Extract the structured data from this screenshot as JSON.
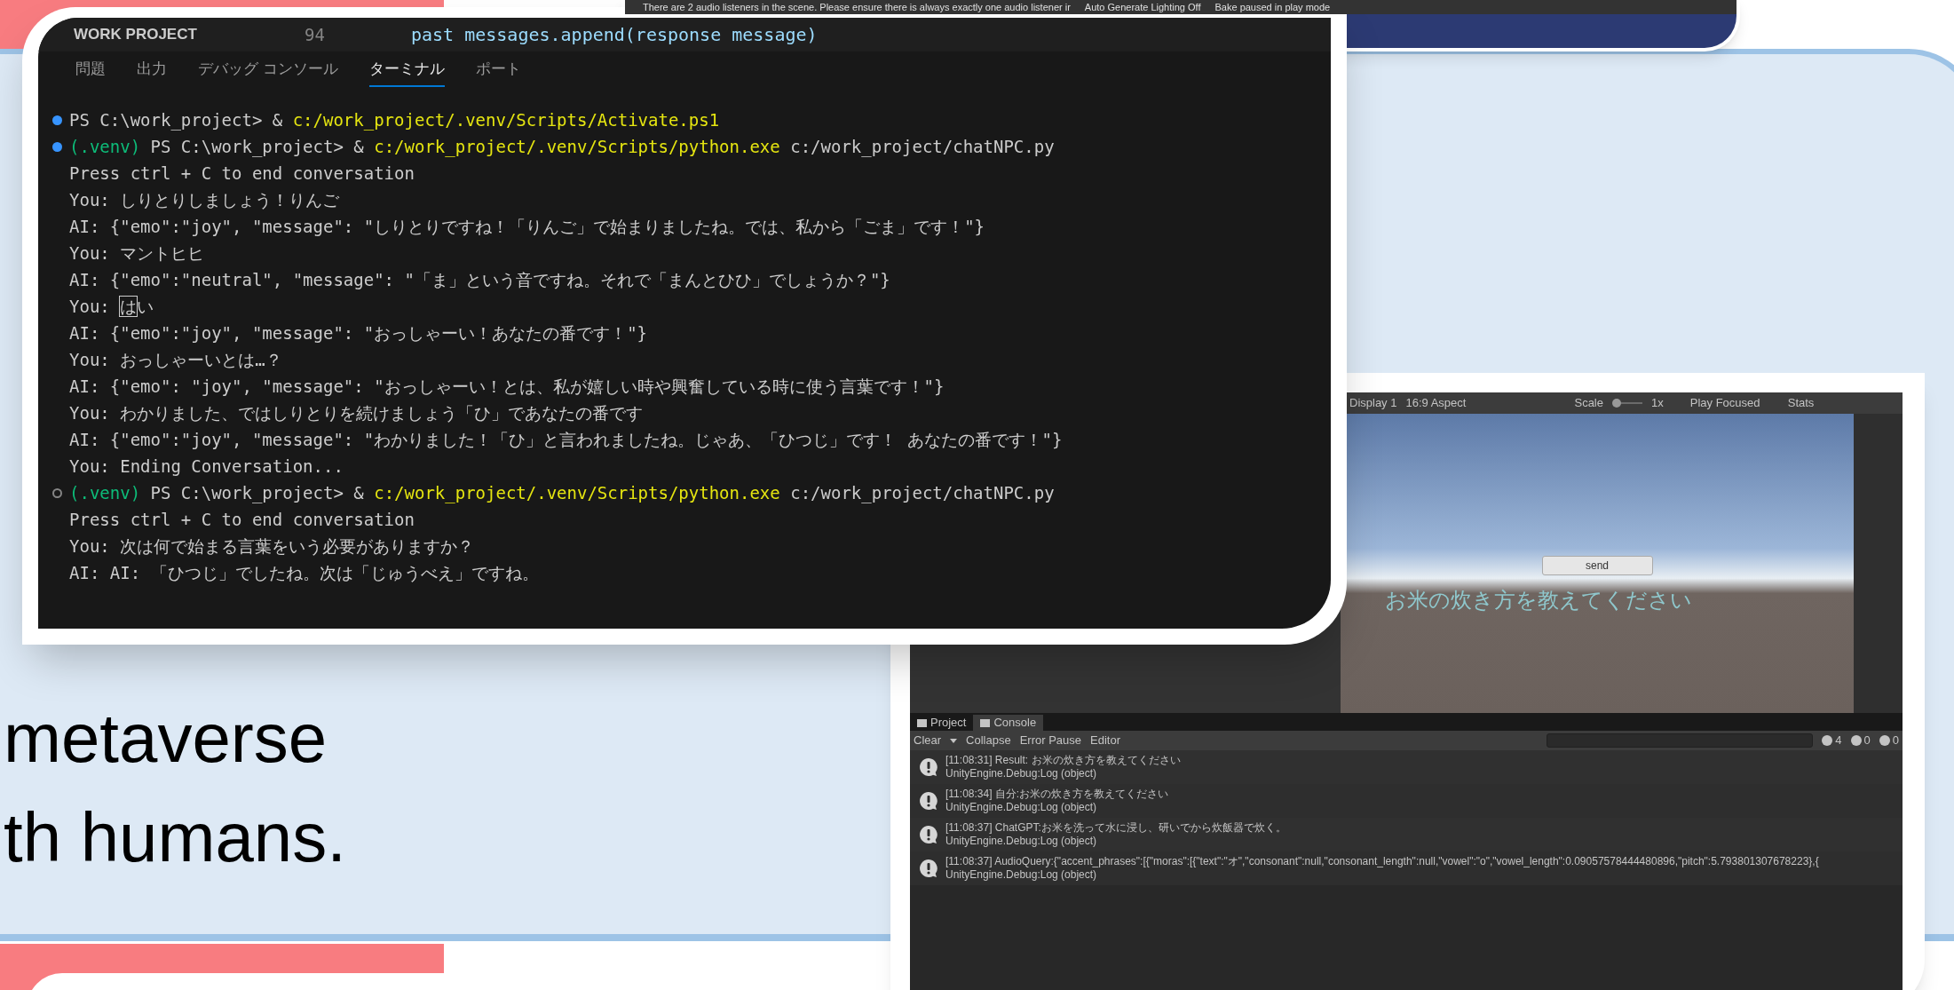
{
  "top_window": {
    "status_text": "There are 2 audio listeners in the scene. Please ensure there is always exactly one audio listener ir",
    "status_items": [
      "Auto Generate Lighting Off",
      "Bake paused in play mode"
    ]
  },
  "terminal": {
    "explorer_title": "WORK PROJECT",
    "line_number": "94",
    "code_line": "past messages.append(response message)",
    "tabs": [
      {
        "label": "問題",
        "selected": false
      },
      {
        "label": "出力",
        "selected": false
      },
      {
        "label": "デバッグ コンソール",
        "selected": false
      },
      {
        "label": "ターミナル",
        "selected": true
      },
      {
        "label": "ポート",
        "selected": false
      }
    ],
    "lines": [
      {
        "succeeded": true,
        "segments": [
          {
            "kind": "plain",
            "text": "PS C:\\work_project> & "
          },
          {
            "kind": "path",
            "text": "c:/work_project/.venv/Scripts/Activate.ps1"
          }
        ]
      },
      {
        "succeeded": true,
        "segments": [
          {
            "kind": "venv",
            "text": "(.venv)"
          },
          {
            "kind": "plain",
            "text": " PS C:\\work_project> & "
          },
          {
            "kind": "path",
            "text": "c:/work_project/.venv/Scripts/python.exe"
          },
          {
            "kind": "plain",
            "text": " c:/work_project/chatNPC.py"
          }
        ]
      },
      {
        "segments": [
          {
            "kind": "plain",
            "text": "Press ctrl + C to end conversation"
          }
        ]
      },
      {
        "segments": [
          {
            "kind": "plain",
            "text": "You: しりとりしましょう！りんご"
          }
        ]
      },
      {
        "segments": [
          {
            "kind": "plain",
            "text": "AI:  {\"emo\":\"joy\", \"message\": \"しりとりですね！「りんご」で始まりましたね。では、私から「ごま」です！\"}"
          }
        ]
      },
      {
        "segments": [
          {
            "kind": "plain",
            "text": "You: マントヒヒ"
          }
        ]
      },
      {
        "segments": [
          {
            "kind": "plain",
            "text": "AI:  {\"emo\":\"neutral\", \"message\": \"「ま」という音ですね。それで「まんとひひ」でしょうか？\"}"
          }
        ]
      },
      {
        "segments": [
          {
            "kind": "plain",
            "text": "You: "
          },
          {
            "kind": "cursor",
            "text": "は"
          },
          {
            "kind": "plain",
            "text": "い"
          }
        ]
      },
      {
        "segments": [
          {
            "kind": "plain",
            "text": "AI:  {\"emo\":\"joy\", \"message\": \"おっしゃーい！あなたの番です！\"}"
          }
        ]
      },
      {
        "segments": [
          {
            "kind": "plain",
            "text": "You: おっしゃーいとは…？"
          }
        ]
      },
      {
        "segments": [
          {
            "kind": "plain",
            "text": "AI:  {\"emo\": \"joy\", \"message\": \"おっしゃーい！とは、私が嬉しい時や興奮している時に使う言葉です！\"}"
          }
        ]
      },
      {
        "segments": [
          {
            "kind": "plain",
            "text": "You: わかりました、ではしりとりを続けましょう「ひ」であなたの番です"
          }
        ]
      },
      {
        "segments": [
          {
            "kind": "plain",
            "text": "AI:  {\"emo\":\"joy\", \"message\": \"わかりました！「ひ」と言われましたね。じゃあ、「ひつじ」です！ あなたの番です！\"}"
          }
        ]
      },
      {
        "segments": [
          {
            "kind": "plain",
            "text": "You: Ending Conversation..."
          }
        ]
      },
      {
        "succeeded": false,
        "segments": [
          {
            "kind": "venv",
            "text": "(.venv)"
          },
          {
            "kind": "plain",
            "text": " PS C:\\work_project> & "
          },
          {
            "kind": "path",
            "text": "c:/work_project/.venv/Scripts/python.exe"
          },
          {
            "kind": "plain",
            "text": " c:/work_project/chatNPC.py"
          }
        ]
      },
      {
        "segments": [
          {
            "kind": "plain",
            "text": "Press ctrl + C to end conversation"
          }
        ]
      },
      {
        "segments": [
          {
            "kind": "plain",
            "text": "You: 次は何で始まる言葉をいう必要がありますか？"
          }
        ]
      },
      {
        "segments": [
          {
            "kind": "plain",
            "text": "AI:  AI: 「ひつじ」でしたね。次は「じゅうべえ」ですね。"
          }
        ]
      }
    ]
  },
  "slide_text": [
    "metaverse",
    "th humans."
  ],
  "unity": {
    "game_toolbar": {
      "display": "Display 1",
      "aspect": "16:9 Aspect",
      "scale_label": "Scale",
      "scale_value": "1x",
      "play_mode": "Play Focused",
      "stats": "Stats"
    },
    "game_view": {
      "button": "send",
      "caption": "お米の炊き方を教えてください"
    },
    "console_tabs": [
      {
        "label": "Project",
        "selected": false
      },
      {
        "label": "Console",
        "selected": true
      }
    ],
    "console_toolbar": {
      "clear": "Clear",
      "collapse": "Collapse",
      "error_pause": "Error Pause",
      "editor": "Editor",
      "counts": [
        "4",
        "0",
        "0"
      ]
    },
    "logs": [
      {
        "message": "[11:08:31] Result: お米の炊き方を教えてください",
        "source": "UnityEngine.Debug:Log (object)"
      },
      {
        "message": "[11:08:34] 自分:お米の炊き方を教えてください",
        "source": "UnityEngine.Debug:Log (object)"
      },
      {
        "message": "[11:08:37] ChatGPT:お米を洗って水に浸し、研いでから炊飯器で炊く。",
        "source": "UnityEngine.Debug:Log (object)"
      },
      {
        "message": "[11:08:37] AudioQuery:{\"accent_phrases\":[{\"moras\":[{\"text\":\"オ\",\"consonant\":null,\"consonant_length\":null,\"vowel\":\"o\",\"vowel_length\":0.09057578444480896,\"pitch\":5.793801307678223},{",
        "source": "UnityEngine.Debug:Log (object)"
      }
    ]
  }
}
